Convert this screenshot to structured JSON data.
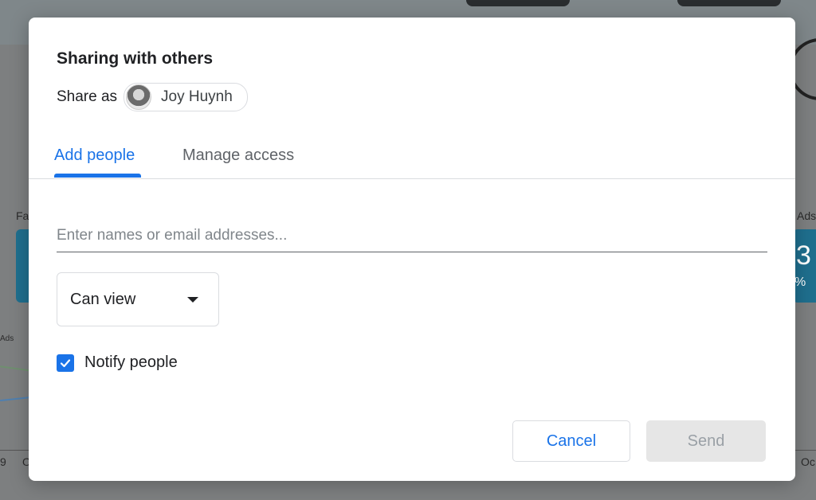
{
  "background": {
    "left_label": "Fa",
    "right_label": "Ads",
    "left_small_label": "Ads",
    "right_card_value": "3",
    "right_card_percent": "%",
    "left_axis_labels": [
      "9",
      "O"
    ],
    "right_axis_label": "Oc"
  },
  "dialog": {
    "title": "Sharing with others",
    "share_as_label": "Share as",
    "account_name": "Joy Huynh",
    "tabs": [
      {
        "label": "Add people",
        "active": true
      },
      {
        "label": "Manage access",
        "active": false
      }
    ],
    "email_input": {
      "value": "",
      "placeholder": "Enter names or email addresses..."
    },
    "permission": {
      "selected": "Can view"
    },
    "notify": {
      "label": "Notify people",
      "checked": true
    },
    "buttons": {
      "cancel": "Cancel",
      "send": "Send"
    }
  },
  "colors": {
    "accent": "#1a73e8",
    "disabled_bg": "#e6e6e6",
    "disabled_text": "#9aa0a6"
  }
}
